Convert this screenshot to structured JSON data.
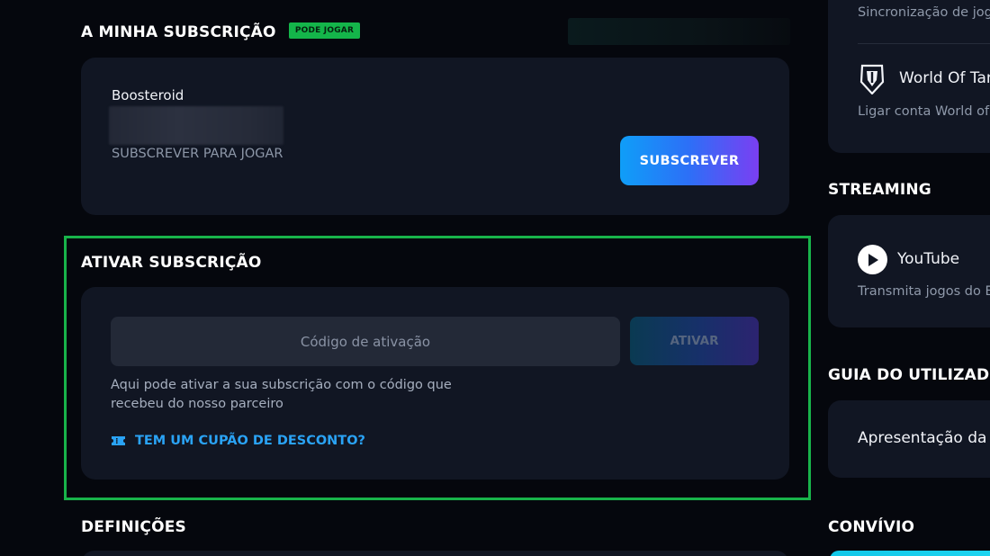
{
  "subscription": {
    "title": "A MINHA SUBSCRIÇÃO",
    "badge": "PODE JOGAR",
    "plan_name": "Boosteroid",
    "status": "SUBSCREVER PARA JOGAR",
    "subscribe_button": "SUBSCREVER"
  },
  "activate": {
    "title": "ATIVAR SUBSCRIÇÃO",
    "code_placeholder": "Código de ativação",
    "code_value": "",
    "activate_button": "ATIVAR",
    "help_text": "Aqui pode ativar a sua subscrição com o código que recebeu do nosso parceiro",
    "coupon_link": "TEM UM CUPÃO DE DESCONTO?"
  },
  "settings": {
    "title": "DEFINIÇÕES"
  },
  "sidebar": {
    "sync_text": "Sincronização de jog",
    "wot": {
      "title": "World Of Tan",
      "subtitle": "Ligar conta World of"
    },
    "streaming": {
      "title": "STREAMING",
      "youtube_title": "YouTube",
      "youtube_subtitle": "Transmita jogos do E"
    },
    "guide": {
      "title": "GUIA DO UTILIZADOR",
      "item": "Apresentação da i"
    },
    "social": {
      "title": "CONVÍVIO"
    }
  },
  "colors": {
    "background": "#05070d",
    "card": "#111623",
    "badge_green": "#14b54a",
    "highlight_green": "#18b34a",
    "link_blue": "#2aa3f5",
    "gradient_start": "#0f9ef8",
    "gradient_end": "#7a3ff2"
  },
  "icons": {
    "wot": "tank-shield-icon",
    "youtube": "youtube-play-icon",
    "coupon": "ticket-icon"
  }
}
